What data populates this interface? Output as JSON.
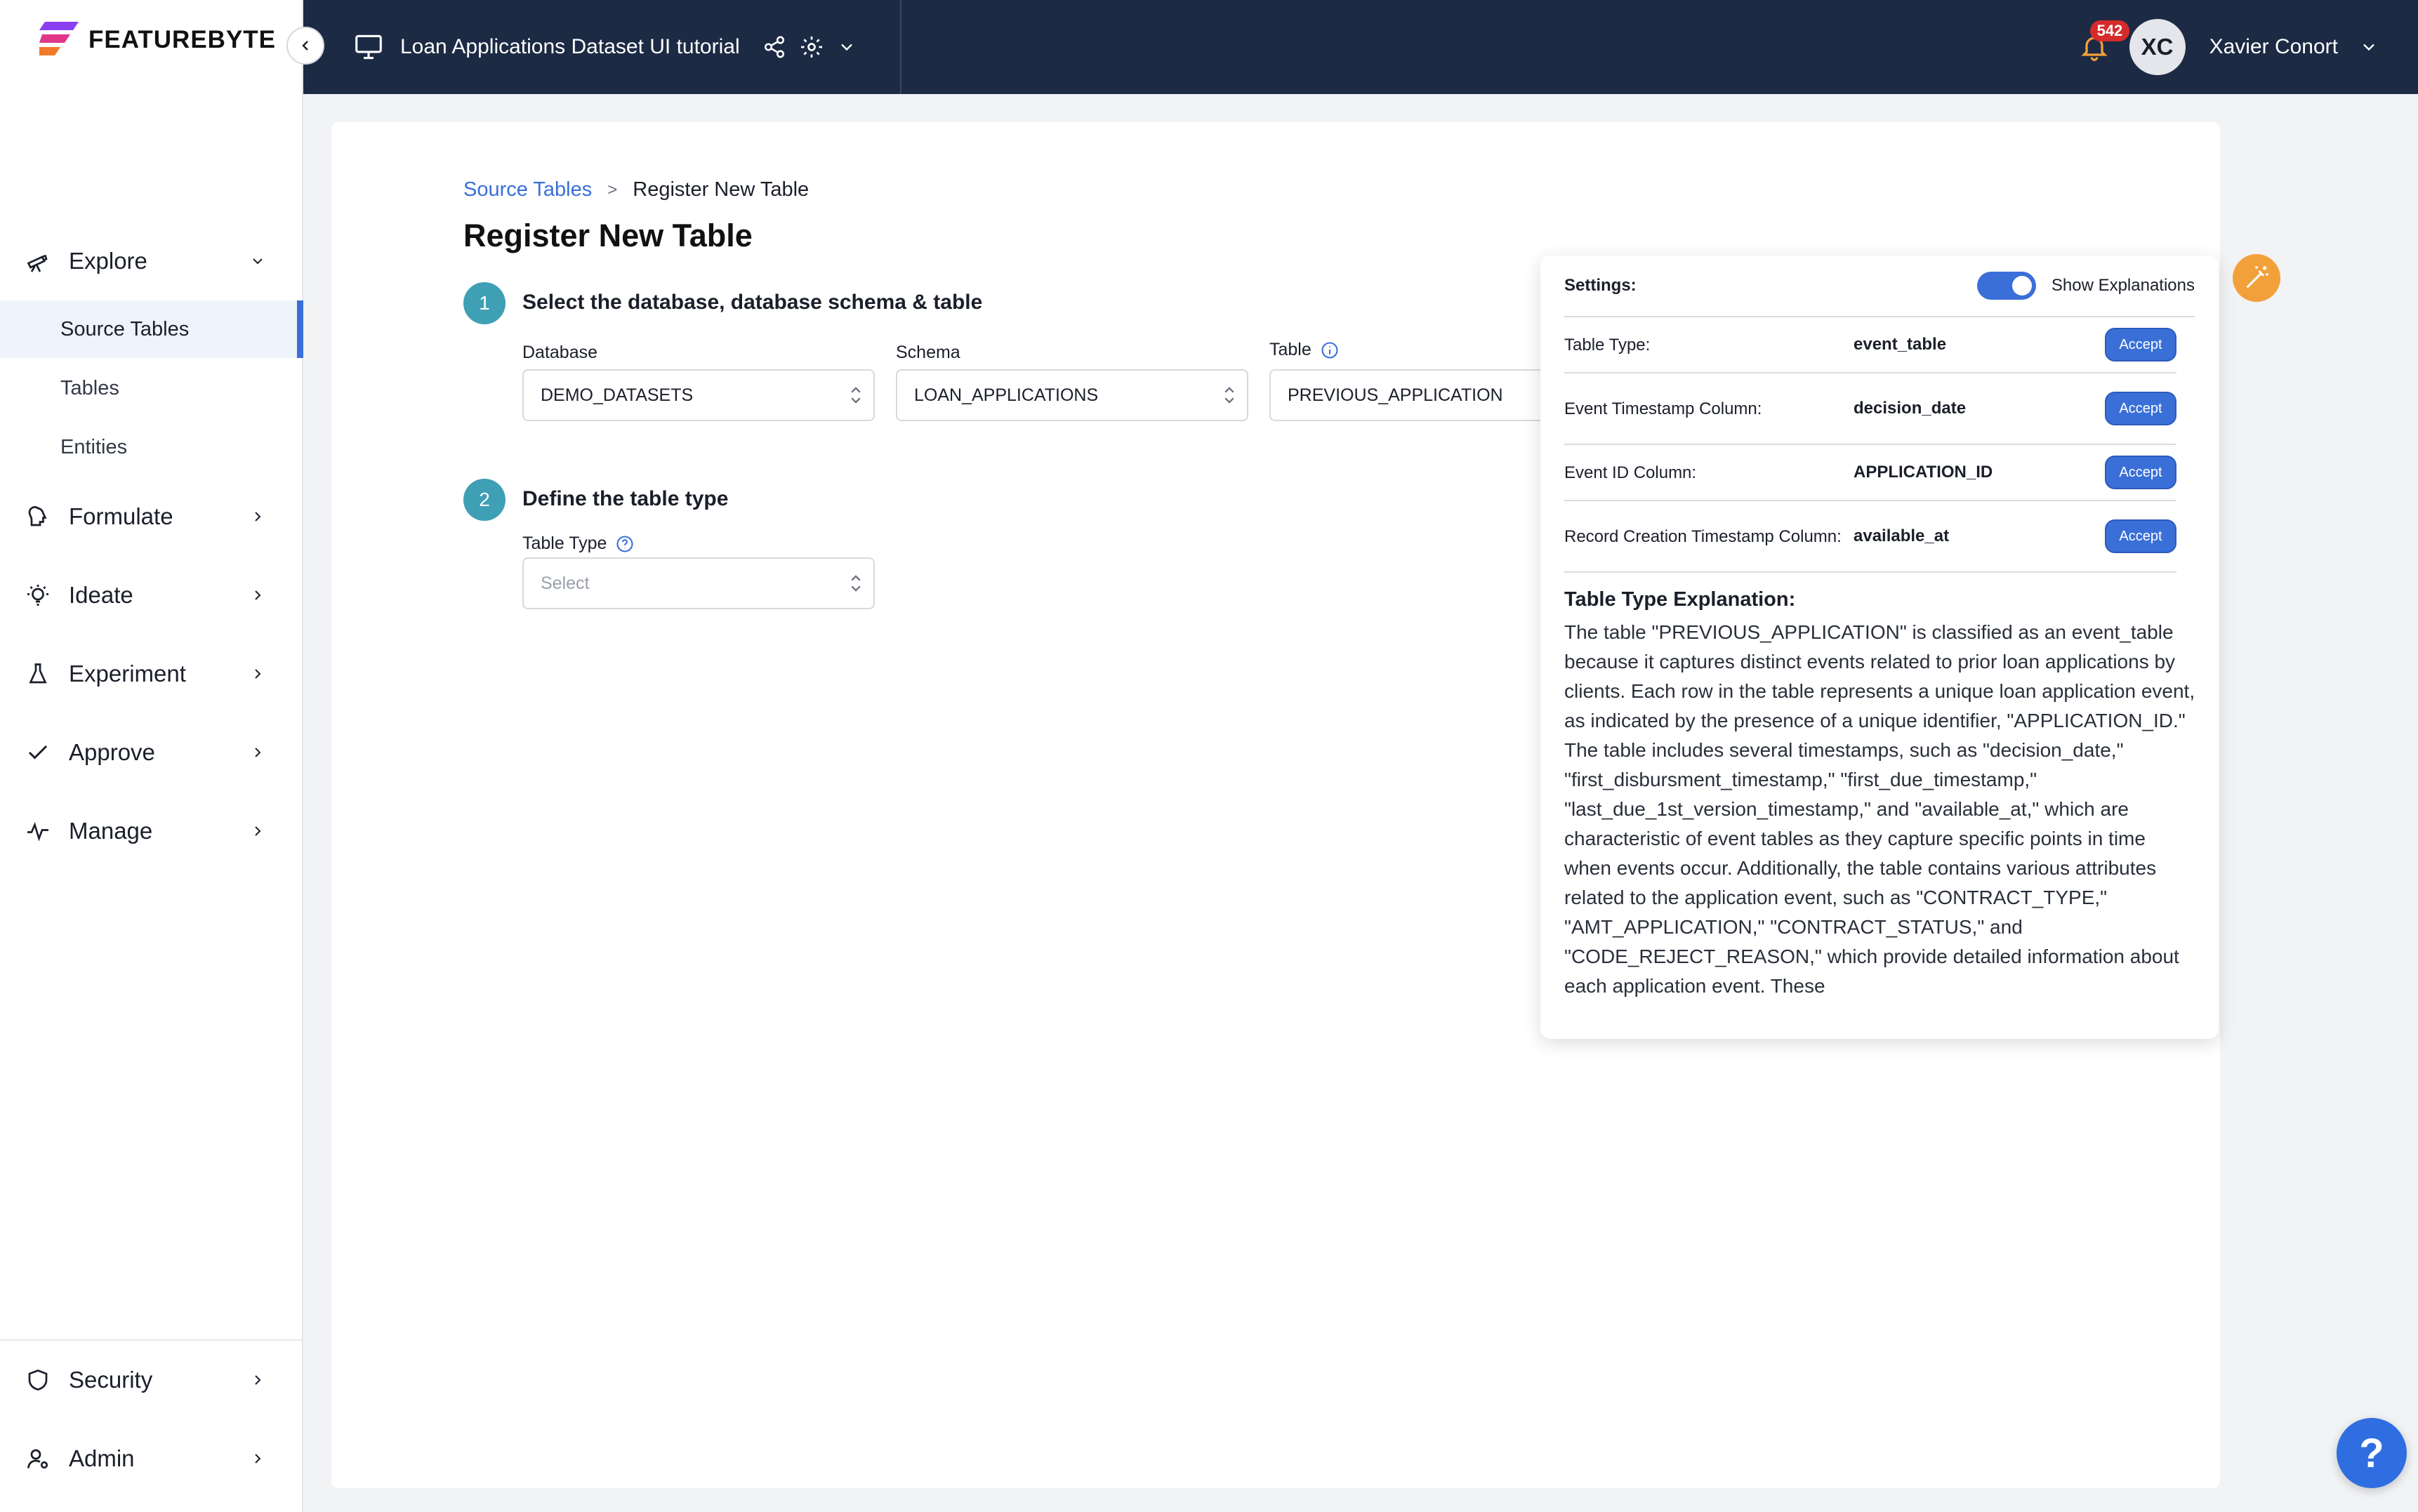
{
  "brand": {
    "logo_text": "FEATUREBYTE"
  },
  "topbar": {
    "catalog_title": "Loan Applications Dataset UI tutorial",
    "notification_count": "542",
    "user_initials": "XC",
    "user_name": "Xavier Conort"
  },
  "sidebar": {
    "groups": [
      {
        "label": "Explore",
        "icon": "telescope-icon"
      },
      {
        "label": "Formulate",
        "icon": "brain-icon"
      },
      {
        "label": "Ideate",
        "icon": "lightbulb-icon"
      },
      {
        "label": "Experiment",
        "icon": "flask-icon"
      },
      {
        "label": "Approve",
        "icon": "check-icon"
      },
      {
        "label": "Manage",
        "icon": "pulse-icon"
      },
      {
        "label": "Security",
        "icon": "shield-icon"
      },
      {
        "label": "Admin",
        "icon": "user-icon"
      }
    ],
    "explore_items": [
      "Source Tables",
      "Tables",
      "Entities"
    ],
    "active_item": "Source Tables"
  },
  "breadcrumb": {
    "parent": "Source Tables",
    "separator": ">",
    "current": "Register New Table"
  },
  "page_title": "Register New Table",
  "step1": {
    "number": "1",
    "title": "Select the database, database schema & table",
    "database_label": "Database",
    "database_value": "DEMO_DATASETS",
    "schema_label": "Schema",
    "schema_value": "LOAN_APPLICATIONS",
    "table_label": "Table",
    "table_value": "PREVIOUS_APPLICATION"
  },
  "step2": {
    "number": "2",
    "title": "Define the table type",
    "table_type_label": "Table Type",
    "table_type_placeholder": "Select"
  },
  "settings_panel": {
    "settings_label": "Settings:",
    "show_explanations_label": "Show Explanations",
    "show_explanations_on": true,
    "rows": [
      {
        "key": "Table Type:",
        "value": "event_table",
        "action": "Accept"
      },
      {
        "key": "Event Timestamp Column:",
        "value": "decision_date",
        "action": "Accept"
      },
      {
        "key": "Event ID Column:",
        "value": "APPLICATION_ID",
        "action": "Accept"
      },
      {
        "key": "Record Creation Timestamp Column:",
        "value": "available_at",
        "action": "Accept"
      }
    ],
    "explanation_title": "Table Type Explanation:",
    "explanation_text": "The table \"PREVIOUS_APPLICATION\" is classified as an event_table because it captures distinct events related to prior loan applications by clients. Each row in the table represents a unique loan application event, as indicated by the presence of a unique identifier, \"APPLICATION_ID.\" The table includes several timestamps, such as \"decision_date,\" \"first_disbursment_timestamp,\" \"first_due_timestamp,\" \"last_due_1st_version_timestamp,\" and \"available_at,\" which are characteristic of event tables as they capture specific points in time when events occur. Additionally, the table contains various attributes related to the application event, such as \"CONTRACT_TYPE,\" \"AMT_APPLICATION,\" \"CONTRACT_STATUS,\" and \"CODE_REJECT_REASON,\" which provide detailed information about each application event. These"
  },
  "help": {
    "label": "?"
  },
  "colors": {
    "accent": "#3a6fd8",
    "topbar": "#1d2a44",
    "step": "#3f9fb5",
    "magic": "#f2a13a",
    "badge": "#d62b2b"
  }
}
